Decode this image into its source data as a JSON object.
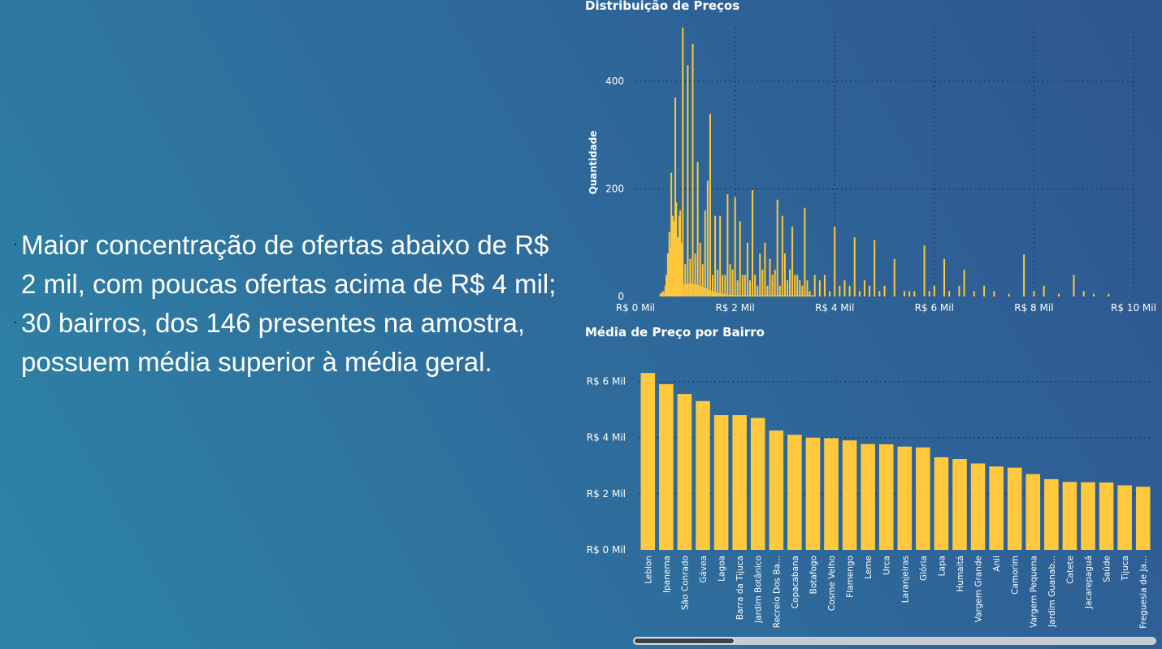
{
  "summary": {
    "bullets": [
      "Maior concentração de ofertas abaixo de R$ 2 mil, com poucas ofertas acima de R$ 4 mil;",
      "30 bairros, dos 146 presentes na amostra, possuem média superior à média geral."
    ]
  },
  "colors": {
    "bar": "#ffc83d",
    "gridline": "#1c2a3a",
    "text": "#ffffff"
  },
  "chart_data": [
    {
      "type": "bar",
      "title": "Distribuição de Preços",
      "xlabel": "",
      "ylabel": "Quantidade",
      "x_unit": "R$ Mil",
      "xlim": [
        0,
        10
      ],
      "ylim": [
        0,
        500
      ],
      "x_ticks": [
        0,
        2,
        4,
        6,
        8,
        10
      ],
      "x_tick_labels": [
        "R$ 0 Mil",
        "R$ 2 Mil",
        "R$ 4 Mil",
        "R$ 6 Mil",
        "R$ 8 Mil",
        "R$ 10 Mil"
      ],
      "y_ticks": [
        0,
        200,
        400
      ],
      "y_tick_labels": [
        "0",
        "200",
        "400"
      ],
      "grid": true,
      "legend": "none",
      "x": [
        0.5,
        0.55,
        0.6,
        0.62,
        0.65,
        0.68,
        0.7,
        0.72,
        0.75,
        0.78,
        0.8,
        0.82,
        0.85,
        0.88,
        0.9,
        0.92,
        0.95,
        1.0,
        1.05,
        1.1,
        1.15,
        1.2,
        1.25,
        1.3,
        1.35,
        1.4,
        1.45,
        1.5,
        1.55,
        1.6,
        1.65,
        1.7,
        1.75,
        1.8,
        1.85,
        1.9,
        1.95,
        2.0,
        2.05,
        2.1,
        2.15,
        2.2,
        2.25,
        2.3,
        2.35,
        2.4,
        2.45,
        2.5,
        2.55,
        2.6,
        2.65,
        2.7,
        2.75,
        2.8,
        2.85,
        2.9,
        2.95,
        3.0,
        3.05,
        3.1,
        3.15,
        3.2,
        3.25,
        3.3,
        3.35,
        3.4,
        3.45,
        3.5,
        3.6,
        3.7,
        3.8,
        3.9,
        4.0,
        4.1,
        4.2,
        4.3,
        4.4,
        4.5,
        4.6,
        4.7,
        4.8,
        4.9,
        5.0,
        5.2,
        5.4,
        5.5,
        5.6,
        5.8,
        5.9,
        6.0,
        6.2,
        6.3,
        6.5,
        6.6,
        6.8,
        7.0,
        7.2,
        7.5,
        7.8,
        8.0,
        8.2,
        8.5,
        8.8,
        9.0,
        9.2,
        9.5
      ],
      "values": [
        5,
        10,
        20,
        40,
        80,
        120,
        90,
        230,
        150,
        140,
        370,
        175,
        110,
        150,
        160,
        100,
        500,
        60,
        430,
        70,
        470,
        80,
        250,
        100,
        60,
        160,
        215,
        340,
        40,
        150,
        50,
        150,
        40,
        40,
        190,
        60,
        50,
        185,
        30,
        140,
        40,
        40,
        100,
        30,
        198,
        40,
        20,
        80,
        50,
        100,
        20,
        70,
        40,
        50,
        180,
        20,
        150,
        80,
        30,
        50,
        130,
        40,
        40,
        30,
        20,
        165,
        30,
        10,
        40,
        30,
        40,
        10,
        130,
        20,
        30,
        20,
        110,
        10,
        30,
        20,
        105,
        10,
        20,
        70,
        10,
        10,
        10,
        95,
        10,
        20,
        70,
        10,
        20,
        50,
        10,
        20,
        10,
        5,
        78,
        10,
        20,
        5,
        40,
        10,
        5,
        5
      ],
      "density_overlay": true
    },
    {
      "type": "bar",
      "title": "Média de Preço por Bairro",
      "xlabel": "",
      "ylabel": "",
      "y_unit": "R$ Mil",
      "ylim": [
        0,
        7
      ],
      "y_ticks": [
        0,
        2,
        4,
        6
      ],
      "y_tick_labels": [
        "R$ 0 Mil",
        "R$ 2 Mil",
        "R$ 4 Mil",
        "R$ 6 Mil"
      ],
      "grid": true,
      "legend": "none",
      "categories": [
        "Leblon",
        "Ipanema",
        "São Conrado",
        "Gávea",
        "Lagoa",
        "Barra da Tijuca",
        "Jardim Botânico",
        "Recreio Dos Ba...",
        "Copacabana",
        "Botafogo",
        "Cosme Velho",
        "Flamengo",
        "Leme",
        "Urca",
        "Laranjeiras",
        "Glória",
        "Lapa",
        "Humaitá",
        "Vargem Grande",
        "Anil",
        "Camorim",
        "Vargem Pequena",
        "Jardim Guanab...",
        "Catete",
        "Jacarepaguá",
        "Saúde",
        "Tijuca",
        "Freguesia de Ja..."
      ],
      "values": [
        6.3,
        5.9,
        5.55,
        5.3,
        4.8,
        4.8,
        4.7,
        4.25,
        4.1,
        4.0,
        3.98,
        3.9,
        3.77,
        3.76,
        3.68,
        3.65,
        3.3,
        3.24,
        3.08,
        2.97,
        2.93,
        2.7,
        2.52,
        2.42,
        2.41,
        2.4,
        2.3,
        2.25
      ]
    }
  ]
}
